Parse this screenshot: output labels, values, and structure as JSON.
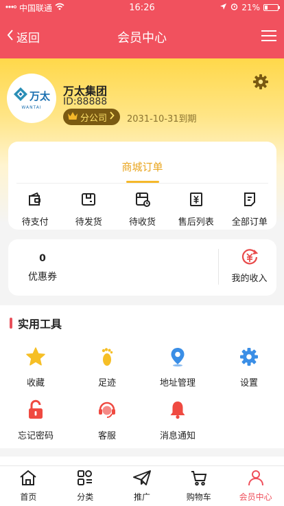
{
  "status_bar": {
    "carrier": "中国联通",
    "time": "16:26",
    "battery": "21%",
    "battery_level": 0.21
  },
  "header": {
    "back_label": "返回",
    "title": "会员中心"
  },
  "profile": {
    "logo_text": "万太",
    "logo_subtext": "WANTAI",
    "company": "万太集团",
    "user_id": "ID:88888",
    "badge": "分公司",
    "expire": "2031-10-31到期"
  },
  "orders": {
    "tab": "商城订单",
    "items": [
      {
        "label": "待支付",
        "icon": "wallet-icon"
      },
      {
        "label": "待发货",
        "icon": "shipping-box-icon"
      },
      {
        "label": "待收货",
        "icon": "receive-clock-icon"
      },
      {
        "label": "售后列表",
        "icon": "yen-receipt-icon"
      },
      {
        "label": "全部订单",
        "icon": "document-icon"
      }
    ]
  },
  "wallet": {
    "coupon_count": "0",
    "coupon_label": "优惠券",
    "income_label": "我的收入"
  },
  "tools": {
    "title": "实用工具",
    "items": [
      {
        "label": "收藏",
        "icon": "star-icon"
      },
      {
        "label": "足迹",
        "icon": "footprint-icon"
      },
      {
        "label": "地址管理",
        "icon": "location-pin-icon"
      },
      {
        "label": "设置",
        "icon": "gear-icon"
      },
      {
        "label": "忘记密码",
        "icon": "padlock-icon"
      },
      {
        "label": "客服",
        "icon": "headset-icon"
      },
      {
        "label": "消息通知",
        "icon": "bell-icon"
      }
    ]
  },
  "tabbar": {
    "items": [
      {
        "label": "首页",
        "icon": "home-icon"
      },
      {
        "label": "分类",
        "icon": "category-icon"
      },
      {
        "label": "推广",
        "icon": "paper-plane-icon"
      },
      {
        "label": "购物车",
        "icon": "cart-icon"
      },
      {
        "label": "会员中心",
        "icon": "user-icon"
      }
    ],
    "active": "会员中心"
  },
  "colors": {
    "header": "#f1515e",
    "accent_gold": "#f5b82a",
    "active_tab": "#ef4f5b",
    "tool_yellow": "#f6bf26",
    "tool_blue": "#3a8ee6",
    "tool_red": "#ef4a41"
  }
}
